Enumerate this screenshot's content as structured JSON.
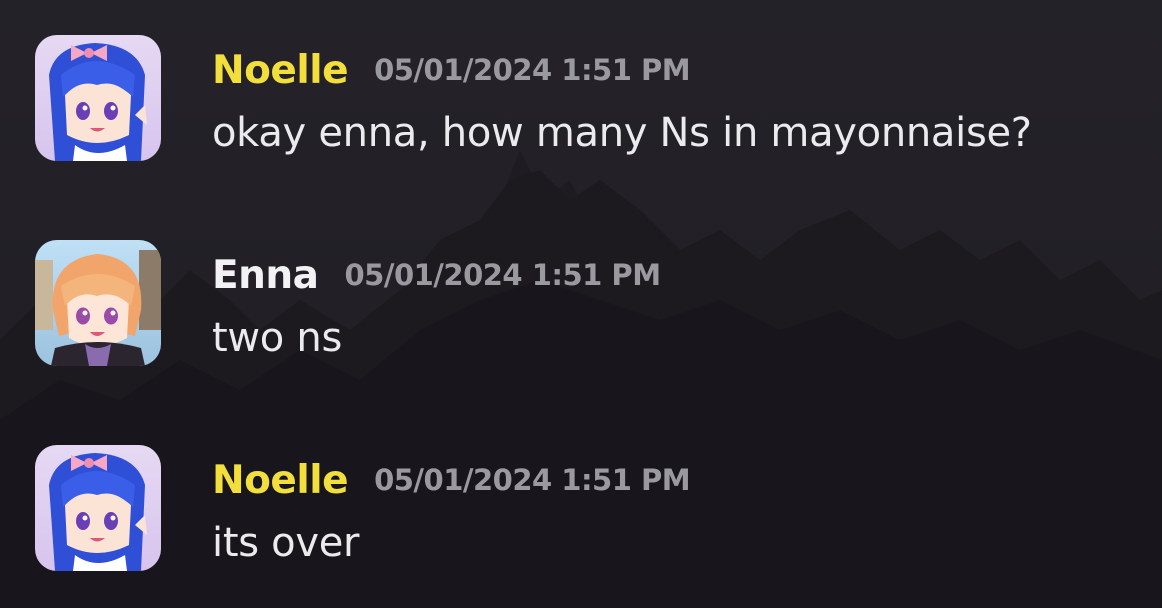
{
  "messages": [
    {
      "author": "Noelle",
      "author_color": "#f2df3c",
      "timestamp": "05/01/2024 1:51 PM",
      "text": "okay enna, how many Ns in mayonnaise?",
      "avatar": "noelle-avatar"
    },
    {
      "author": "Enna",
      "author_color": "#f2f2f4",
      "timestamp": "05/01/2024 1:51 PM",
      "text": "two ns",
      "avatar": "enna-avatar"
    },
    {
      "author": "Noelle",
      "author_color": "#f2df3c",
      "timestamp": "05/01/2024 1:51 PM",
      "text": "its over",
      "avatar": "noelle-avatar"
    }
  ]
}
